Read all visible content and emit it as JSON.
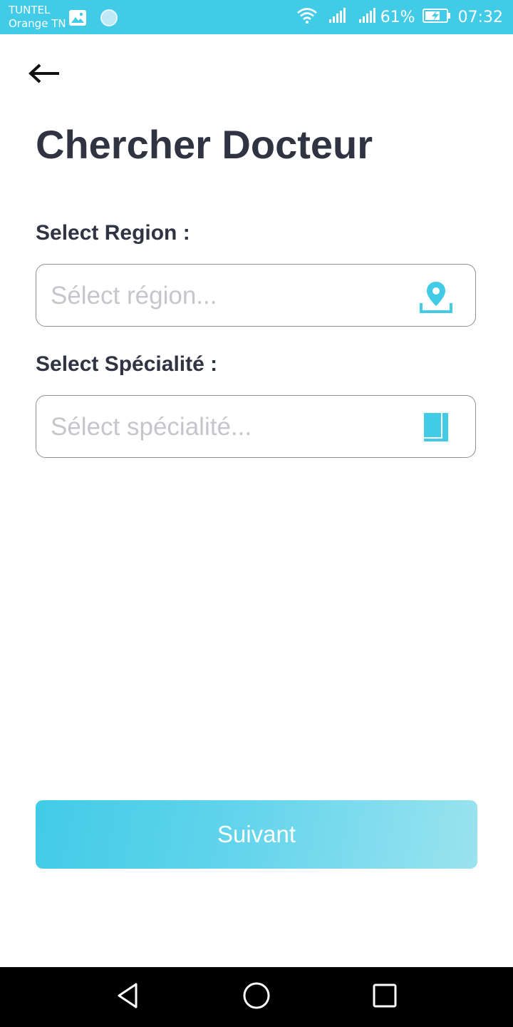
{
  "status_bar": {
    "carrier_line1": "TUNTEL",
    "carrier_line2": "Orange TN",
    "battery_percent": "61%",
    "time": "07:32",
    "icons": [
      "image-icon",
      "circle-app-icon",
      "wifi-icon",
      "signal-icon",
      "signal-icon",
      "battery-charging-icon"
    ]
  },
  "header": {
    "back_icon": "arrow-left-icon",
    "title": "Chercher Docteur"
  },
  "region": {
    "label": "Select Region :",
    "placeholder": "Sélect région...",
    "icon": "map-pin-icon"
  },
  "specialite": {
    "label": "Select Spécialité :",
    "placeholder": "Sélect spécialité...",
    "icon": "book-icon"
  },
  "next_button": {
    "label": "Suivant"
  },
  "nav_bar": {
    "icons": [
      "back-triangle-icon",
      "home-circle-icon",
      "recents-square-icon"
    ]
  },
  "colors": {
    "accent": "#41cbe7",
    "title_text": "#2f3342",
    "placeholder_text": "#c4c6cb",
    "border": "#8e9096"
  }
}
